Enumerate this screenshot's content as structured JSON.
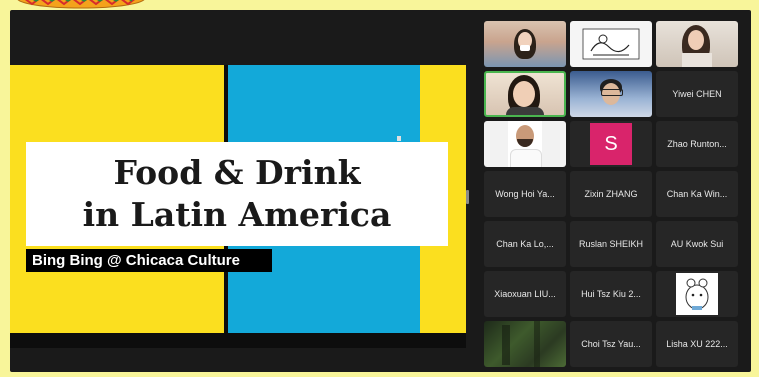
{
  "slide": {
    "title_line1": "Food & Drink",
    "title_line2": "in Latin America",
    "subtitle": "Bing Bing @ Chicaca Culture"
  },
  "participants": [
    {
      "name": "",
      "type": "video",
      "scene": "sky"
    },
    {
      "name": "",
      "type": "image",
      "scene": "sketch"
    },
    {
      "name": "",
      "type": "video",
      "scene": "office"
    },
    {
      "name": "",
      "type": "video",
      "scene": "room",
      "active_speaker": true
    },
    {
      "name": "",
      "type": "video",
      "scene": "blue"
    },
    {
      "name": "Yiwei CHEN",
      "type": "name"
    },
    {
      "name": "",
      "type": "video",
      "scene": "portrait"
    },
    {
      "name": "",
      "type": "avatar",
      "initial": "S",
      "color": "#d9246b"
    },
    {
      "name": "Zhao Runton...",
      "type": "name"
    },
    {
      "name": "Wong Hoi Ya...",
      "type": "name"
    },
    {
      "name": "Zixin ZHANG",
      "type": "name"
    },
    {
      "name": "Chan Ka Win...",
      "type": "name"
    },
    {
      "name": "Chan Ka Lo,...",
      "type": "name"
    },
    {
      "name": "Ruslan SHEIKH",
      "type": "name"
    },
    {
      "name": "AU Kwok Sui",
      "type": "name"
    },
    {
      "name": "Xiaoxuan LIU...",
      "type": "name"
    },
    {
      "name": "Hui Tsz Kiu 2...",
      "type": "name"
    },
    {
      "name": "",
      "type": "image",
      "scene": "cartoon"
    },
    {
      "name": "",
      "type": "video",
      "scene": "forest"
    },
    {
      "name": "Choi Tsz Yau...",
      "type": "name"
    },
    {
      "name": "Lisha XU 222...",
      "type": "name"
    }
  ],
  "colors": {
    "page_background": "#f8f59a",
    "slide_yellow": "#fbdf1f",
    "slide_blue": "#13a9d9",
    "active_speaker_border": "#4ab54f",
    "tile_background": "#262626"
  },
  "icons": {
    "decoration": "sombrero-icon"
  }
}
